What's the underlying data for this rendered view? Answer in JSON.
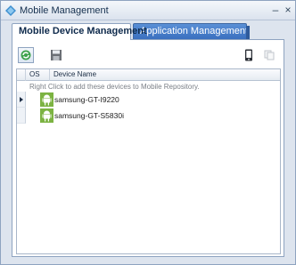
{
  "window": {
    "title": "Mobile Management"
  },
  "tabs": [
    {
      "label": "Mobile Device Management",
      "active": true
    },
    {
      "label": "Application Management",
      "active": false
    }
  ],
  "grid": {
    "columns": [
      "OS",
      "Device Name"
    ],
    "hint": "Right Click to add these devices to Mobile Repository.",
    "rows": [
      {
        "os_icon": "android-icon",
        "device_name": "samsung-GT-I9220",
        "current": true
      },
      {
        "os_icon": "android-icon",
        "device_name": "samsung-GT-S5830i",
        "current": false
      }
    ]
  },
  "colors": {
    "accent": "#3a6fbf",
    "android_green": "#8bc34a"
  }
}
